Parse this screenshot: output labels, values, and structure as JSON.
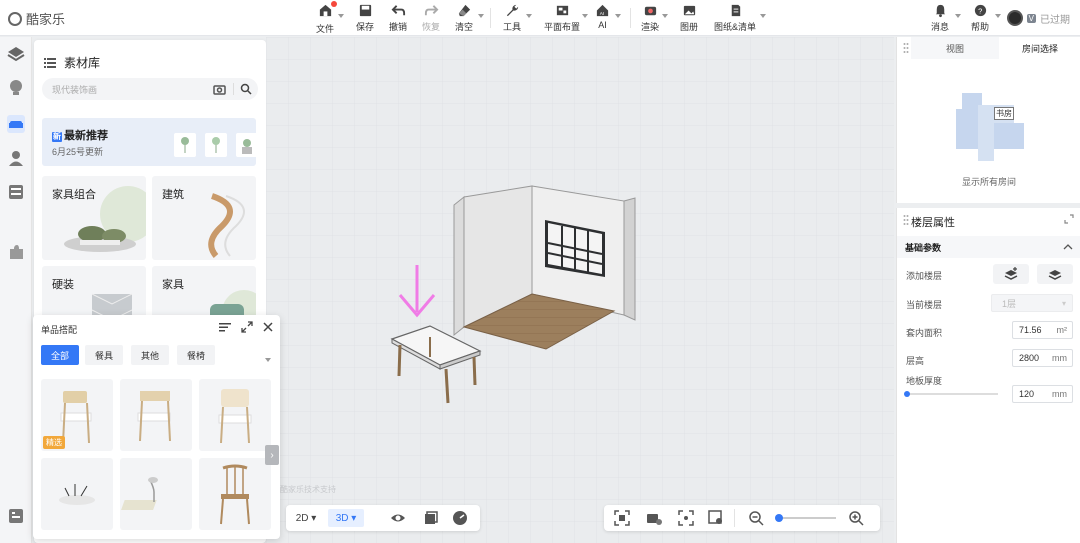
{
  "app": {
    "logo_text": "酷家乐"
  },
  "toolbar": {
    "items": [
      {
        "label": "文件",
        "icon": "file-home-icon"
      },
      {
        "label": "保存",
        "icon": "save-icon"
      },
      {
        "label": "撤销",
        "icon": "undo-icon"
      },
      {
        "label": "恢复",
        "icon": "redo-icon"
      },
      {
        "label": "清空",
        "icon": "eraser-icon"
      },
      {
        "label": "工具",
        "icon": "wrench-icon"
      },
      {
        "label": "平面布置",
        "icon": "floorplan-icon"
      },
      {
        "label": "AI",
        "icon": "ai-house-icon"
      },
      {
        "label": "渲染",
        "icon": "camera-icon"
      },
      {
        "label": "图册",
        "icon": "album-icon"
      },
      {
        "label": "图纸&清单",
        "icon": "document-icon"
      }
    ],
    "message_label": "消息",
    "help_label": "帮助",
    "account_status": "已过期"
  },
  "material_library": {
    "title": "素材库",
    "search_placeholder": "现代装饰画",
    "new_rec_title": "最新推荐",
    "new_rec_date": "6月25号更新",
    "categories": [
      "家具组合",
      "建筑",
      "硬装",
      "家具"
    ]
  },
  "single_item_popup": {
    "title": "单品搭配",
    "filters": [
      "全部",
      "餐具",
      "其他",
      "餐椅"
    ],
    "featured_tag": "精选"
  },
  "viewport": {
    "watermark": "酷家乐技术支持",
    "view_modes": [
      "2D",
      "3D"
    ],
    "active_mode": "3D",
    "zoom_level": 0.05
  },
  "right_panel": {
    "tabs": [
      "视图",
      "房间选择"
    ],
    "active_tab": "房间选择",
    "room_label": "书房",
    "show_all": "显示所有房间",
    "floor_props_title": "楼层属性",
    "basic_params": "基础参数",
    "add_floor_label": "添加楼层",
    "current_floor_label": "当前楼层",
    "current_floor_value": "1层",
    "area_label": "套内面积",
    "area_value": "71.56",
    "area_unit": "m²",
    "height_label": "层高",
    "height_value": "2800",
    "height_unit": "mm",
    "slab_label": "地板厚度",
    "slab_value": "120",
    "slab_unit": "mm"
  },
  "colors": {
    "accent": "#3478f6",
    "pink_arrow": "#f07ce6",
    "featured": "#f2a83b"
  }
}
